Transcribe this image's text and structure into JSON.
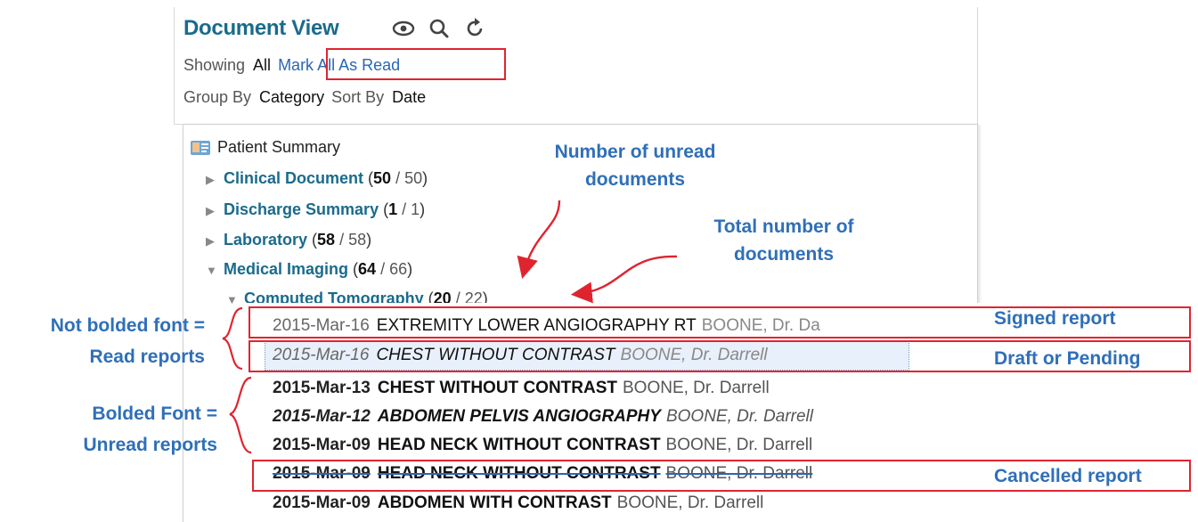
{
  "header": {
    "title": "Document View",
    "icons": [
      "eye-icon",
      "search-icon",
      "refresh-icon"
    ],
    "showing_label": "Showing",
    "showing_value": "All",
    "mark_all_link": "Mark All As Read",
    "group_by_label": "Group By",
    "group_by_value": "Category",
    "sort_by_label": "Sort By",
    "sort_by_value": "Date"
  },
  "tree": {
    "root": "Patient Summary",
    "categories": [
      {
        "name": "Clinical Document",
        "unread": "50",
        "total": "50"
      },
      {
        "name": "Discharge Summary",
        "unread": "1",
        "total": "1"
      },
      {
        "name": "Laboratory",
        "unread": "58",
        "total": "58"
      },
      {
        "name": "Medical Imaging",
        "unread": "64",
        "total": "66"
      }
    ],
    "subcategory": {
      "name": "Computed Tomography",
      "unread": "20",
      "total": "22"
    },
    "documents": [
      {
        "date": "2015-Mar-16",
        "title": "EXTREMITY LOWER ANGIOGRAPHY RT",
        "author": "BOONE, Dr. Da"
      },
      {
        "date": "2015-Mar-16",
        "title": "CHEST WITHOUT CONTRAST",
        "author": "BOONE, Dr. Darrell"
      },
      {
        "date": "2015-Mar-13",
        "title": "CHEST WITHOUT CONTRAST",
        "author": "BOONE, Dr. Darrell"
      },
      {
        "date": "2015-Mar-12",
        "title": "ABDOMEN PELVIS ANGIOGRAPHY",
        "author": "BOONE, Dr. Darrell"
      },
      {
        "date": "2015-Mar-09",
        "title": "HEAD NECK WITHOUT CONTRAST",
        "author": "BOONE, Dr. Darrell"
      },
      {
        "date": "2015-Mar-09",
        "title": "HEAD NECK WITHOUT CONTRAST",
        "author": "BOONE, Dr. Darrell"
      },
      {
        "date": "2015-Mar-09",
        "title": "ABDOMEN WITH CONTRAST",
        "author": "BOONE, Dr. Darrell"
      }
    ]
  },
  "annotations": {
    "unread_count_1": "Number of unread",
    "unread_count_2": "documents",
    "total_count_1": "Total number of",
    "total_count_2": "documents",
    "not_bolded_1": "Not bolded font =",
    "not_bolded_2": "Read reports",
    "bolded_1": "Bolded Font =",
    "bolded_2": "Unread reports",
    "signed": "Signed report",
    "draft": "Draft or Pending",
    "cancelled": "Cancelled report"
  },
  "colors": {
    "accent": "#1a6b8c",
    "link": "#2a66b5",
    "annotation": "#2f6fb8",
    "highlight_box": "#e0242f"
  }
}
